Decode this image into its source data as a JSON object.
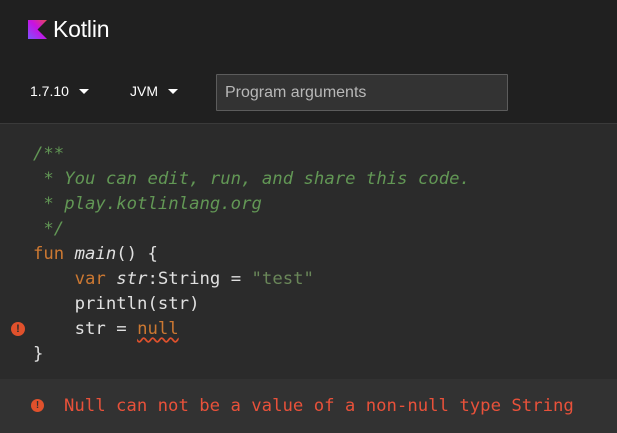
{
  "header": {
    "brand_name": "Kotlin",
    "logo_icon": "kotlin-logo-icon",
    "logo_colors": [
      "#7f52ff",
      "#c811e2"
    ]
  },
  "toolbar": {
    "version_label": "1.7.10",
    "target_label": "JVM",
    "args_placeholder": "Program arguments",
    "args_value": ""
  },
  "editor": {
    "lines": [
      {
        "comment": "/**"
      },
      {
        "comment": " * You can edit, run, and share this code."
      },
      {
        "comment": " * play.kotlinlang.org"
      },
      {
        "comment": " */"
      },
      {
        "kw_fun": "fun",
        "fn_name": "main",
        "rest": "() {"
      },
      {
        "indent": "    ",
        "kw_var": "var",
        "var_name": "str",
        "type_sep": ":",
        "type_name": "String",
        "eq": " = ",
        "string": "\"test\""
      },
      {
        "text": "    println(str)"
      },
      {
        "indent": "    ",
        "lhs": "str = ",
        "kw_null": "null"
      },
      {
        "text": "}"
      }
    ],
    "gutter_error_line": 8
  },
  "console": {
    "error_message": "Null can not be a value of a non-null type String"
  },
  "colors": {
    "background": "#2b2b2b",
    "header_bg": "#202020",
    "comment": "#629755",
    "keyword": "#cc7832",
    "string": "#6a8759",
    "error": "#e0512c"
  }
}
